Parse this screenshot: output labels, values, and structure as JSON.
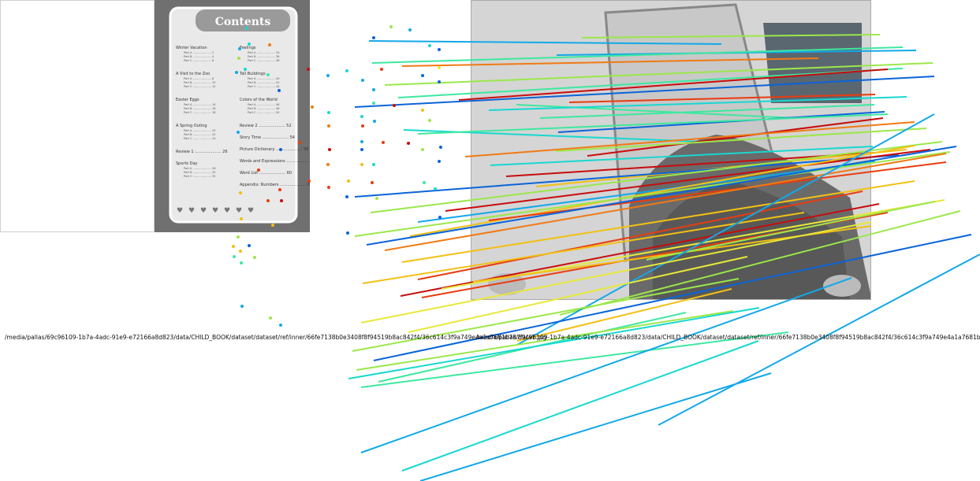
{
  "captions": {
    "left": "/media/pallas/69c96109-1b7a-4adc-91e9-e72166a8d823/data/CHILD_BOOK/dataset/dataset/ref/inner/66fe7138b0e3408f8f94519b8ac842f4/36c614c3f9a749e4a1a7681b787fafa1.jpg",
    "right": "/media/pallas/69c96109-1b7a-4adc-91e9-e72166a8d823/data/CHILD_BOOK/dataset/dataset/ref/inner/66fe7138b0e3408f8f94519b8ac842f4/36c614c3f9a749e4a1a7681b787fafa1.jpg"
  },
  "page": {
    "title": "Contents",
    "left_column": [
      {
        "title": "Winter Vacation",
        "parts": [
          "Part A ..................... 2",
          "Part B ..................... 4",
          "Part C ..................... 6"
        ]
      },
      {
        "title": "A Visit to the Zoo",
        "parts": [
          "Part A ..................... 8",
          "Part B ..................... 10",
          "Part C ..................... 12"
        ]
      },
      {
        "title": "Easter Eggs",
        "parts": [
          "Part A ..................... 14",
          "Part B ..................... 16",
          "Part C ..................... 18"
        ]
      },
      {
        "title": "A Spring Outing",
        "parts": [
          "Part A ..................... 20",
          "Part B ..................... 22",
          "Part C ..................... 24"
        ]
      },
      {
        "title": "Review 1 ..................... 26",
        "parts": []
      },
      {
        "title": "Sports Day",
        "parts": [
          "Part A ..................... 28",
          "Part B ..................... 30",
          "Part C ..................... 32"
        ]
      }
    ],
    "right_column": [
      {
        "title": "Feelings",
        "parts": [
          "Part A ..................... 34",
          "Part B ..................... 36",
          "Part C ..................... 38"
        ]
      },
      {
        "title": "Tall Buildings",
        "parts": [
          "Part A ..................... 40",
          "Part B ..................... 42",
          "Part C ..................... 44"
        ]
      },
      {
        "title": "Colors of the World",
        "parts": [
          "Part A ..................... 46",
          "Part B ..................... 48",
          "Part C ..................... 50"
        ]
      },
      {
        "title": "Review 2 ..................... 52",
        "parts": []
      },
      {
        "title": "Story Time ..................... 54",
        "parts": []
      },
      {
        "title": "Picture Dictionary ..................... 56",
        "parts": []
      },
      {
        "title": "Words and Expressions ..................... 58",
        "parts": []
      },
      {
        "title": "Word List ..................... 60",
        "parts": []
      },
      {
        "title": "Appendix: Numbers ..................... 62",
        "parts": []
      }
    ]
  },
  "colors": {
    "palette": [
      "#0a64d8",
      "#13a8e8",
      "#18d8d0",
      "#3ee8a0",
      "#9be84a",
      "#e8e83a",
      "#f2c014",
      "#f07a14",
      "#e83c10",
      "#c80c0c"
    ]
  }
}
